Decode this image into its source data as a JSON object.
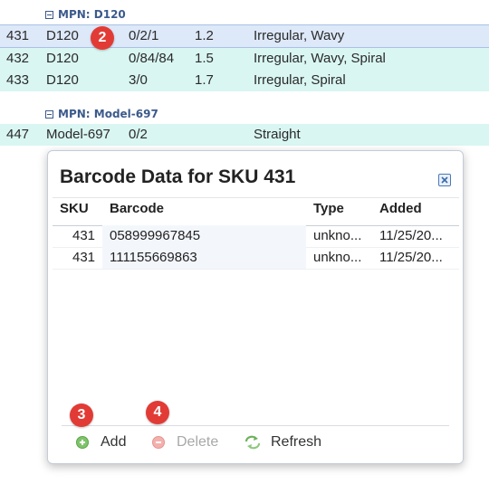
{
  "grid": {
    "groups": [
      {
        "header": "MPN: D120"
      },
      {
        "header": "MPN: Model-697"
      }
    ],
    "rows": [
      {
        "sku": "431",
        "mpn": "D120",
        "qty": "0/2/1",
        "size": "1.2",
        "shape": "Irregular, Wavy"
      },
      {
        "sku": "432",
        "mpn": "D120",
        "qty": "0/84/84",
        "size": "1.5",
        "shape": "Irregular, Wavy, Spiral"
      },
      {
        "sku": "433",
        "mpn": "D120",
        "qty": "3/0",
        "size": "1.7",
        "shape": "Irregular, Spiral"
      },
      {
        "sku": "447",
        "mpn": "Model-697",
        "qty": "0/2",
        "size": "",
        "shape": "Straight"
      }
    ]
  },
  "badges": {
    "b2": "2",
    "b3": "3",
    "b4": "4"
  },
  "dialog": {
    "title": "Barcode Data for SKU 431",
    "columns": {
      "sku": "SKU",
      "barcode": "Barcode",
      "type": "Type",
      "added": "Added"
    },
    "rows": [
      {
        "sku": "431",
        "barcode": "058999967845",
        "type": "unkno...",
        "added": "11/25/20..."
      },
      {
        "sku": "431",
        "barcode": "111155669863",
        "type": "unkno...",
        "added": "11/25/20..."
      }
    ],
    "toolbar": {
      "add": "Add",
      "delete": "Delete",
      "refresh": "Refresh"
    }
  },
  "colors": {
    "accent": "#3b5a8c",
    "row_alt": "#d9f6f2",
    "row_selected": "#dde8f8",
    "badge": "#e23b35"
  }
}
